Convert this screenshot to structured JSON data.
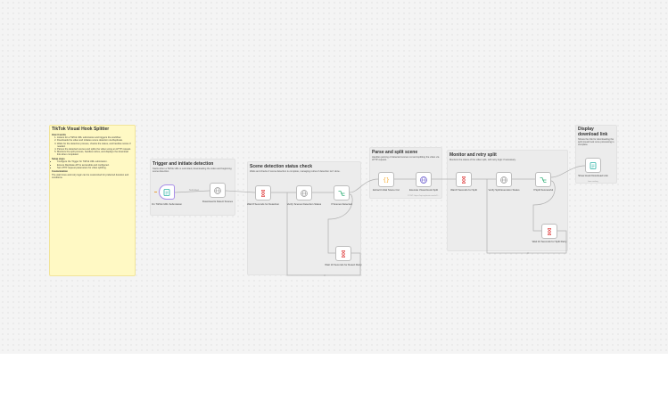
{
  "notes": {
    "title": "TikTok Visual Hook Splitter",
    "how_heading": "How it works",
    "how_items": [
      "Listens for a TikTok URL submission and triggers the workflow.",
      "Downloads the video and initiates scene detection via Replicate.",
      "Waits for the detection process, checks the status, and handles retries if needed.",
      "Parses the detected scenes and splits the video using an HTTP request.",
      "Monitors the split process, handles retries, and displays the download link when completed."
    ],
    "setup_heading": "Setup steps",
    "setup_items": [
      "Configure the Trigger for TikTok URL submission.",
      "Ensure Replicate API is accessible and configured.",
      "Set HTTP request parameters for video splitting."
    ],
    "custom_heading": "Customization",
    "custom_text": "The wait times and retry logic can be customized for preferred duration and conditions."
  },
  "groups": [
    {
      "title": "Trigger and initiate detection",
      "desc": "Starts when a TikTok URL is submitted, downloading the video and beginning scene detection."
    },
    {
      "title": "Scene detection status check",
      "desc": "Waits and checks if scene detection is complete, managing retries if detection isn't done."
    },
    {
      "title": "Parse and split scene",
      "desc": "Handles parsing of detected scenes cut and splitting the video via HTTP request."
    },
    {
      "title": "Monitor and retry split",
      "desc": "Monitors the status of the video split, with retry logic if necessary."
    },
    {
      "title": "Display download link",
      "desc": "Shows the link for downloading the split visual hook once processing is complete."
    }
  ],
  "nodes": [
    {
      "label": "On TikTok URL Submission",
      "icon": "form-icon"
    },
    {
      "label": "Download & Detect Scenes",
      "icon": "globe-icon"
    },
    {
      "label": "Wait 8 Seconds for Detection",
      "icon": "hourglass-icon"
    },
    {
      "label": "Verify Scenes Detection Status",
      "icon": "globe-icon"
    },
    {
      "label": "If Scenes Detected",
      "icon": "branch-icon"
    },
    {
      "label": "Wait 10 Seconds for Detect Retry",
      "icon": "hourglass-icon"
    },
    {
      "label": "Extract Initial Scene Cut",
      "icon": "code-icon"
    },
    {
      "label": "Execute Visual Hook Split",
      "icon": "http-icon",
      "sub": "POST: https://api.replicate.com/v1/..."
    },
    {
      "label": "Wait 8 Seconds for Split",
      "icon": "hourglass-icon"
    },
    {
      "label": "Verify Split Execution Status",
      "icon": "globe-icon"
    },
    {
      "label": "If Split Successful",
      "icon": "branch-icon"
    },
    {
      "label": "Wait 10 Seconds for Split Retry",
      "icon": "hourglass-icon"
    },
    {
      "label": "Show Hook Download Link",
      "icon": "form-icon",
      "sub": "form ending"
    }
  ],
  "edge_labels": {
    "submission": "Submitted"
  },
  "colors": {
    "trigger_accent": "#a88ee8",
    "code_accent": "#f5a623",
    "http_accent": "#6a5acd",
    "branch_accent": "#3bb27d",
    "wait_accent": "#e14b4b"
  }
}
